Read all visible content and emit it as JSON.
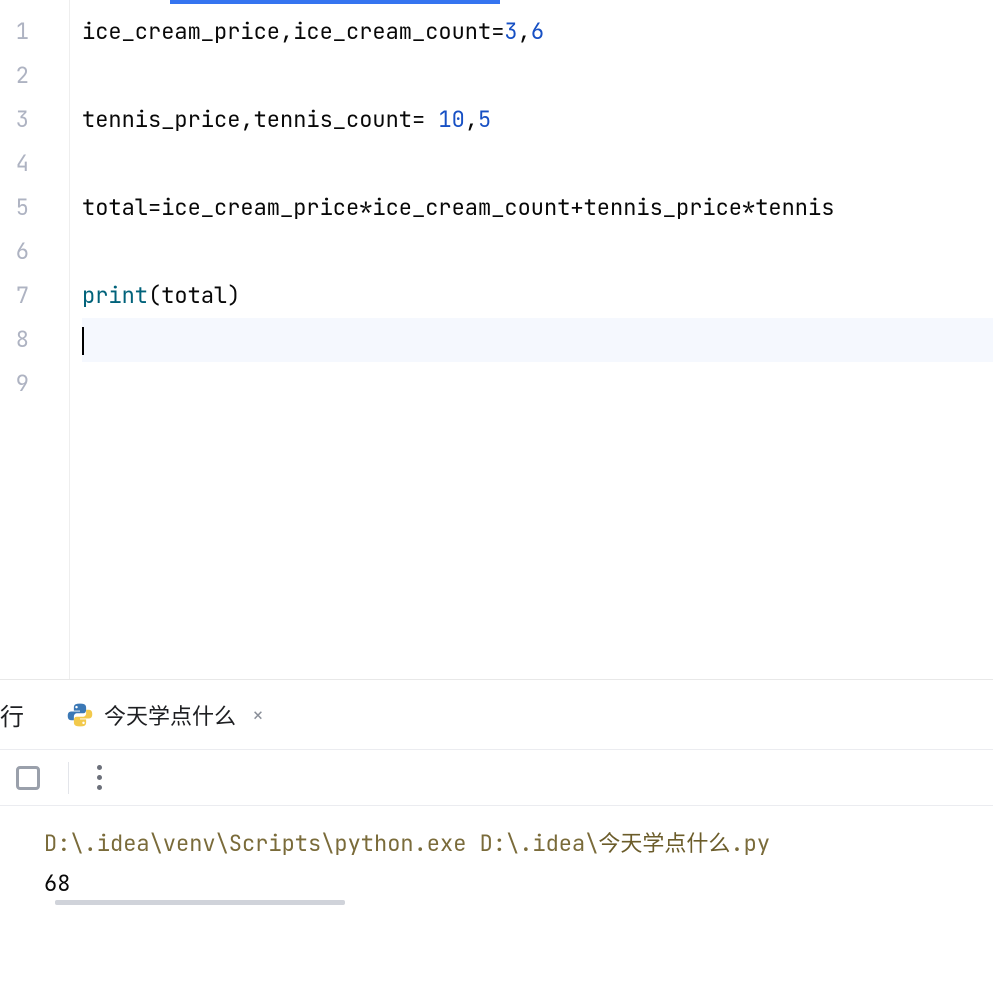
{
  "editor": {
    "lines": [
      {
        "n": "1",
        "segments": [
          {
            "t": "ice_cream_price,ice_cream_count=",
            "c": "tok-plain"
          },
          {
            "t": "3",
            "c": "tok-num"
          },
          {
            "t": ",",
            "c": "tok-plain"
          },
          {
            "t": "6",
            "c": "tok-num"
          }
        ]
      },
      {
        "n": "2",
        "segments": []
      },
      {
        "n": "3",
        "segments": [
          {
            "t": "tennis_price,tennis_count= ",
            "c": "tok-plain"
          },
          {
            "t": "10",
            "c": "tok-num"
          },
          {
            "t": ",",
            "c": "tok-plain"
          },
          {
            "t": "5",
            "c": "tok-num"
          }
        ]
      },
      {
        "n": "4",
        "segments": []
      },
      {
        "n": "5",
        "segments": [
          {
            "t": "total=ice_cream_price*ice_cream_count+tennis_price*tennis",
            "c": "tok-plain"
          }
        ]
      },
      {
        "n": "6",
        "segments": []
      },
      {
        "n": "7",
        "segments": [
          {
            "t": "print",
            "c": "tok-builtin"
          },
          {
            "t": "(total)",
            "c": "tok-plain"
          }
        ]
      },
      {
        "n": "8",
        "segments": [],
        "current": true,
        "caret": true
      },
      {
        "n": "9",
        "segments": []
      }
    ]
  },
  "run": {
    "panel_label": "行",
    "tab_label": "今天学点什么",
    "close_glyph": "×"
  },
  "console": {
    "command_prefix": "D:\\.idea\\venv\\Scripts\\python.exe D:\\.idea\\",
    "command_file": "今天学点什么",
    "command_ext": ".py",
    "output": "68"
  }
}
